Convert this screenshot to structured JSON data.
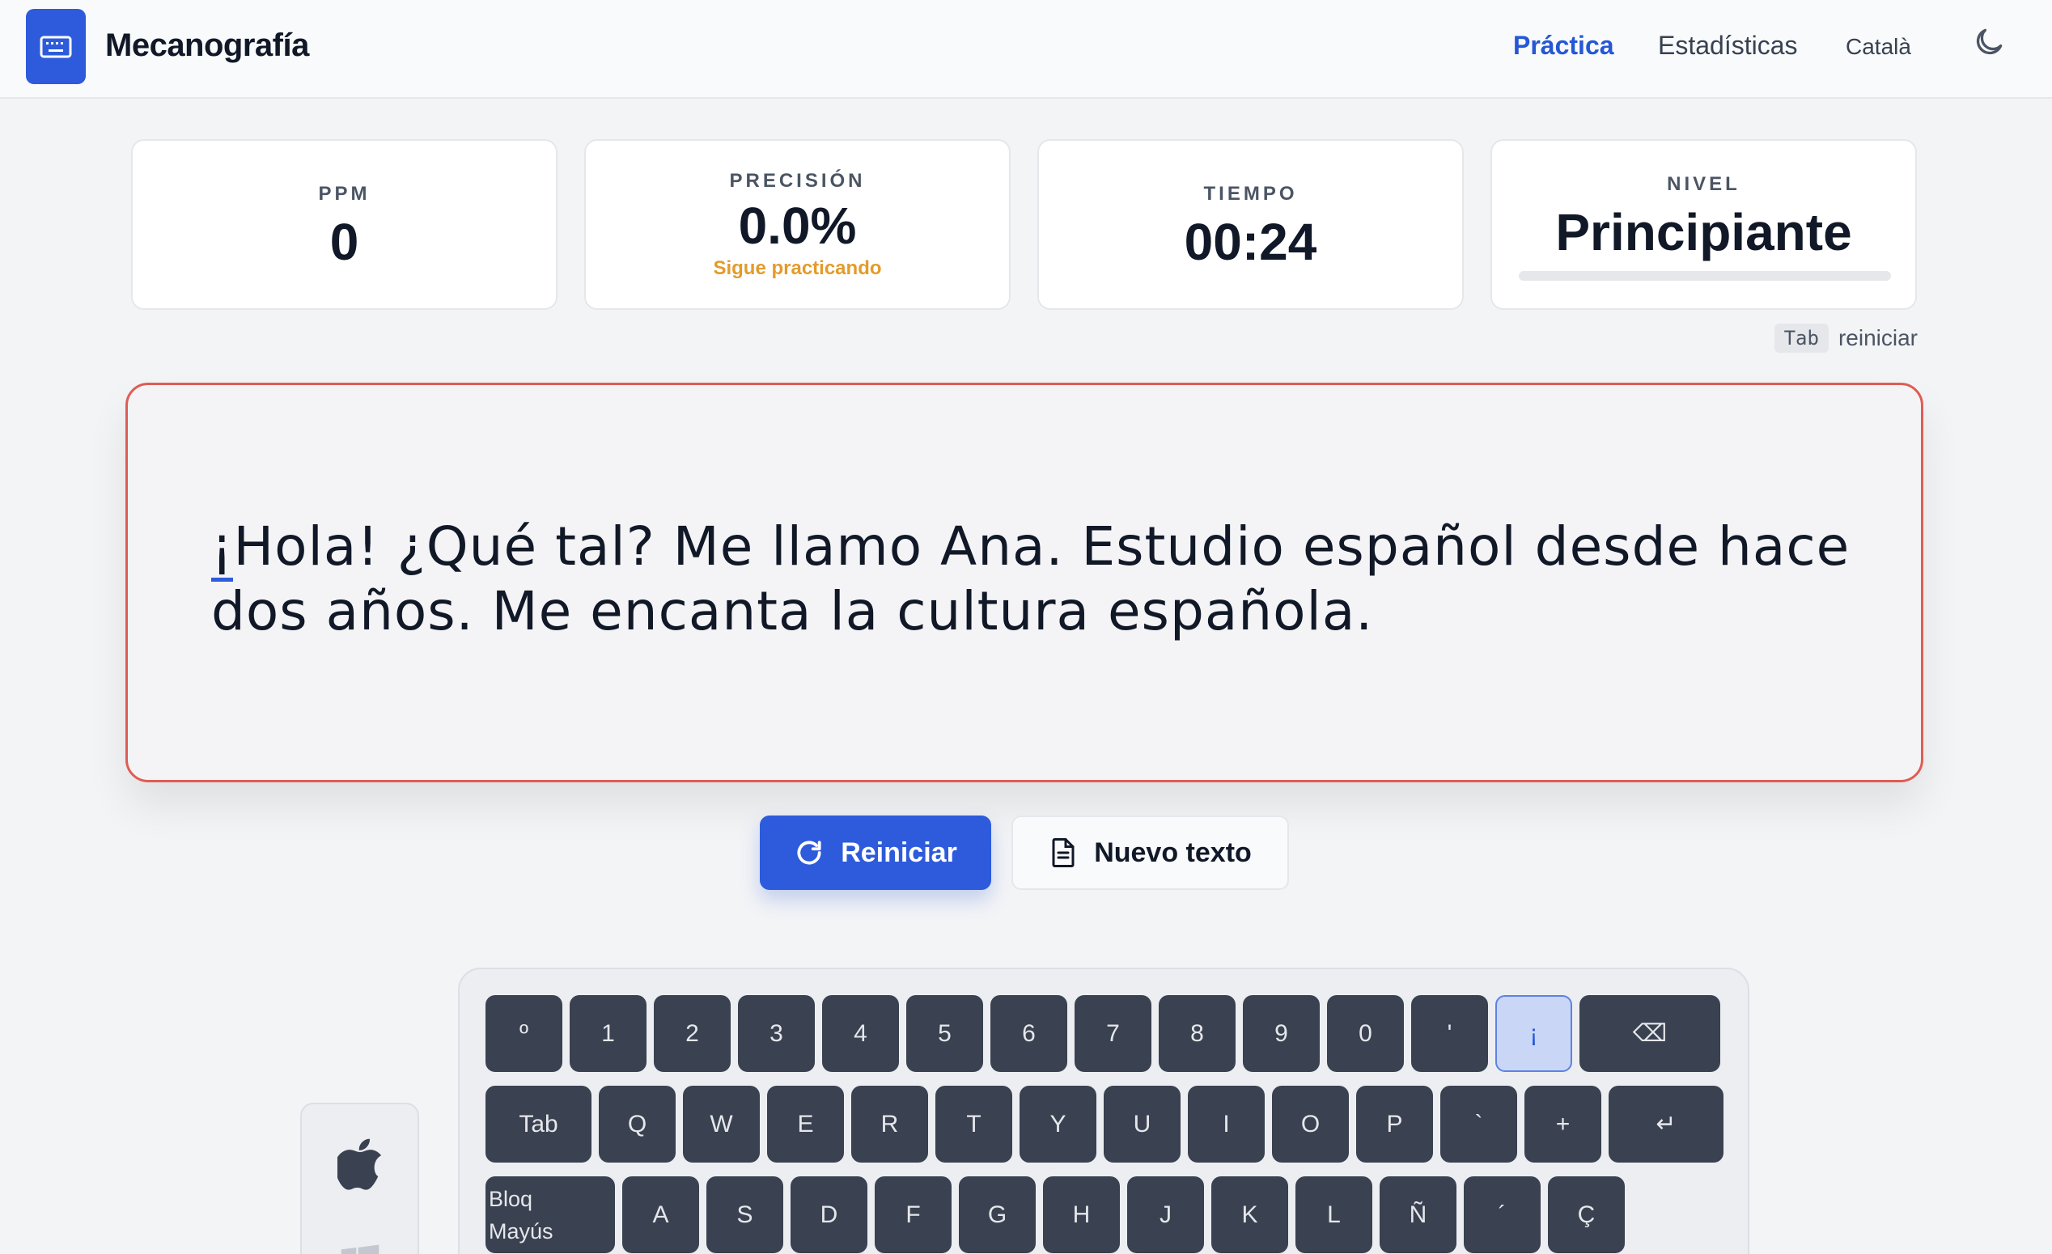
{
  "header": {
    "brand": "Mecanografía",
    "nav": {
      "practica": "Práctica",
      "estadisticas": "Estadísticas",
      "language": "Català"
    },
    "icons": {
      "logo": "keyboard-icon",
      "theme": "moon-icon"
    }
  },
  "stats": {
    "ppm": {
      "label": "PPM",
      "value": "0"
    },
    "precision": {
      "label": "PRECISIÓN",
      "value": "0.0%",
      "note": "Sigue practicando"
    },
    "tiempo": {
      "label": "TIEMPO",
      "value": "00:24"
    },
    "nivel": {
      "label": "NIVEL",
      "value": "Principiante",
      "progress": 0
    }
  },
  "hint": {
    "key": "Tab",
    "text": "reiniciar"
  },
  "practice_text": {
    "current_char": "¡",
    "remaining": "Hola! ¿Qué tal? Me llamo Ana. Estudio español desde hace dos años. Me encanta la cultura española."
  },
  "buttons": {
    "reiniciar": "Reiniciar",
    "nuevo_texto": "Nuevo texto"
  },
  "keyboard": {
    "row1": [
      "º",
      "1",
      "2",
      "3",
      "4",
      "5",
      "6",
      "7",
      "8",
      "9",
      "0",
      "'",
      "¡",
      "⌫"
    ],
    "row2": [
      "Tab",
      "Q",
      "W",
      "E",
      "R",
      "T",
      "Y",
      "U",
      "I",
      "O",
      "P",
      "`",
      "+",
      "↵"
    ],
    "row3": [
      "Bloq Mayús",
      "A",
      "S",
      "D",
      "F",
      "G",
      "H",
      "J",
      "K",
      "L",
      "Ñ",
      "´",
      "Ç"
    ],
    "active_key": "¡"
  },
  "colors": {
    "accent": "#2d5bdc",
    "text_border": "#de5d55",
    "warning": "#e39b2c",
    "key": "#3a4150"
  }
}
